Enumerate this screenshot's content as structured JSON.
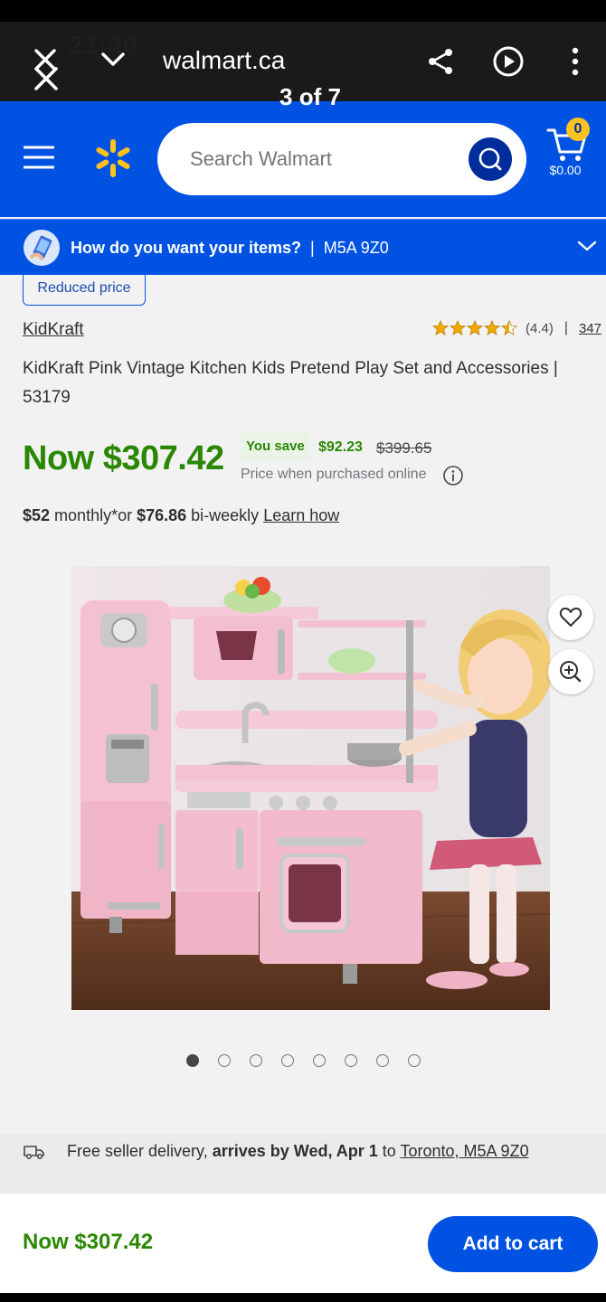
{
  "status_bar": {
    "time": "21:40"
  },
  "browser": {
    "host": "walmart.ca",
    "viewer_counter": "3 of 7"
  },
  "header": {
    "search": {
      "placeholder": "Search Walmart"
    },
    "cart": {
      "count": "0",
      "total": "$0.00"
    }
  },
  "fulfillment": {
    "question": "How do you want your items?",
    "separator": "|",
    "postal": "M5A 9Z0"
  },
  "product": {
    "badge": "Reduced price",
    "brand": "KidKraft",
    "rating": {
      "value": 4.4,
      "label": "(4.4)",
      "separator": "|",
      "count": "347"
    },
    "title": "KidKraft Pink Vintage Kitchen Kids Pretend Play Set and Accessories | 53179",
    "price_now": "Now $307.42",
    "you_save_label": "You save",
    "you_save_amount": "$92.23",
    "was_price": "$399.65",
    "price_note": "Price when purchased online",
    "financing": {
      "monthly_amount": "$52",
      "monthly_text": " monthly*or ",
      "biweekly_amount": "$76.86",
      "biweekly_text": " bi-weekly ",
      "link": "Learn how"
    },
    "gallery": {
      "total": 8,
      "active": 1
    }
  },
  "delivery": {
    "prefix": "Free seller delivery, ",
    "arrives": "arrives by Wed, Apr 1",
    "to": " to ",
    "location": "Toronto, M5A 9Z0"
  },
  "bottom_bar": {
    "price": "Now $307.42",
    "add_to_cart": "Add to cart"
  },
  "colors": {
    "walmart_blue": "#0053e2",
    "spark_yellow": "#ffc220",
    "price_green": "#2a8703"
  }
}
